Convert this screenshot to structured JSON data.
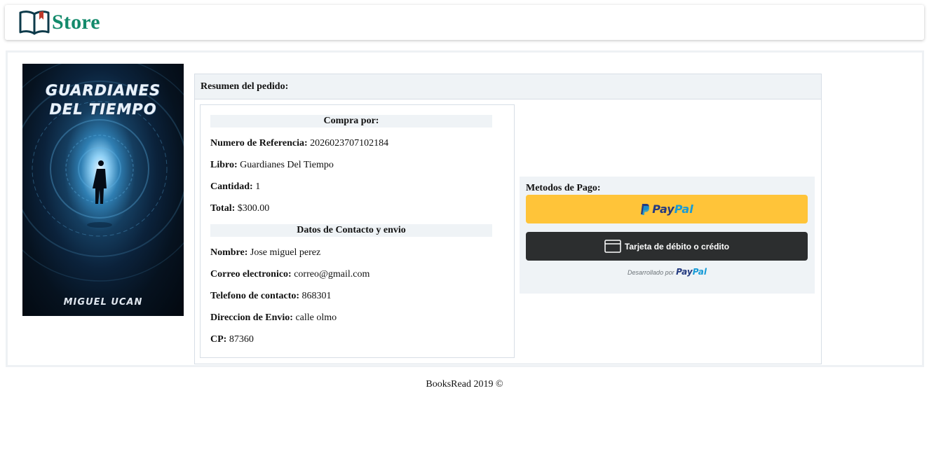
{
  "app": {
    "brand": "Store"
  },
  "book_cover": {
    "title_line1": "Guardianes",
    "title_line2": "Del Tiempo",
    "author": "Miguel Ucan"
  },
  "order": {
    "header": "Resumen del pedido:",
    "purchase_section_title": "Compra por:",
    "reference_label": "Numero de Referencia:",
    "reference_value": "2026023707102184",
    "book_label": "Libro:",
    "book_value": "Guardianes Del Tiempo",
    "quantity_label": "Cantidad:",
    "quantity_value": "1",
    "total_label": "Total:",
    "total_value": "$300.00",
    "contact_section_title": "Datos de Contacto y envio",
    "name_label": "Nombre:",
    "name_value": "Jose miguel perez",
    "email_label": "Correo electronico:",
    "email_value": "correo@gmail.com",
    "phone_label": "Telefono de contacto:",
    "phone_value": "868301",
    "address_label": "Direccion de Envio:",
    "address_value": "calle olmo",
    "zip_label": "CP:",
    "zip_value": "87360"
  },
  "payment": {
    "title": "Metodos de Pago:",
    "paypal_text_a": "Pay",
    "paypal_text_b": "Pal",
    "card_button_label": "Tarjeta de débito o crédito",
    "powered_by": "Desarrollado por",
    "powered_brand_a": "Pay",
    "powered_brand_b": "Pal",
    "colors": {
      "paypal_yellow": "#ffc439",
      "card_black": "#2c2e2f",
      "paypal_dark_blue": "#253b80",
      "paypal_light_blue": "#179bd7"
    }
  },
  "footer": {
    "text": "BooksRead 2019 ©"
  },
  "theme": {
    "brand_color": "#138a6b",
    "panel_bg": "#eff3f6",
    "border": "#d7dee6"
  },
  "icons": [
    "open-book-icon",
    "paypal-p-icon",
    "credit-card-icon"
  ]
}
